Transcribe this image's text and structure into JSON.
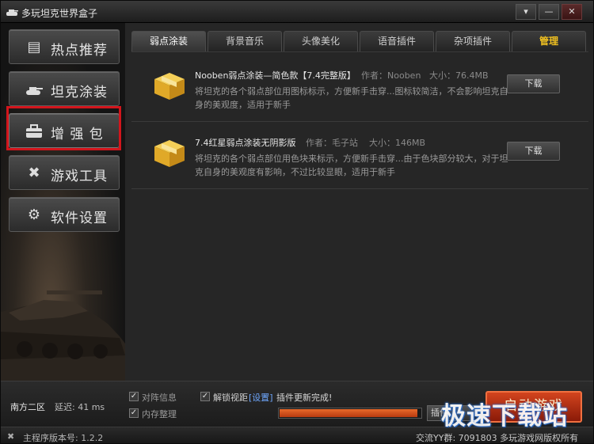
{
  "window": {
    "title": "多玩坦克世界盒子",
    "buttons": {
      "menu": "▾",
      "minimize": "—",
      "close": "✕"
    }
  },
  "sidebar": {
    "items": [
      {
        "label": "热点推荐",
        "icon": "hot-doc-icon"
      },
      {
        "label": "坦克涂装",
        "icon": "tank-icon"
      },
      {
        "label": "增 强 包",
        "icon": "briefcase-icon",
        "highlighted": true
      },
      {
        "label": "游戏工具",
        "icon": "tools-icon"
      },
      {
        "label": "软件设置",
        "icon": "gear-icon"
      }
    ]
  },
  "tabs": [
    {
      "label": "弱点涂装",
      "active": true
    },
    {
      "label": "背景音乐"
    },
    {
      "label": "头像美化"
    },
    {
      "label": "语音插件"
    },
    {
      "label": "杂项插件"
    },
    {
      "label": "管理"
    }
  ],
  "plugins": [
    {
      "title": "Nooben弱点涂装—简色款【7.4完整版】",
      "author": "作者：Nooben",
      "size": "大小：76.4MB",
      "desc": "将坦克的各个弱点部位用图标标示，方便新手击穿...图标较简洁，不会影响坦克自身的美观度，适用于新手",
      "download_label": "下载"
    },
    {
      "title": "7.4红星弱点涂装无阴影版",
      "author": "作者：毛子站",
      "size": "大小：146MB",
      "desc": "将坦克的各个弱点部位用色块来标示，方便新手击穿...由于色块部分较大，对于坦克自身的美观度有影响，不过比较显眼，适用于新手",
      "download_label": "下载"
    }
  ],
  "bottom": {
    "server": "南方二区",
    "latency": "延迟: 41 ms",
    "options": [
      {
        "label": "对阵信息",
        "checked": true
      },
      {
        "label": "内存整理",
        "checked": true
      }
    ],
    "unlock_view": {
      "label": "解锁视距",
      "checked": true,
      "link": "[设置]"
    },
    "status_text": "插件更新完成!",
    "progress": 0.98,
    "plugin_button": "插件",
    "launch_button": "启动游戏"
  },
  "statusbar": {
    "version": "主程序版本号: 1.2.2",
    "qq_group": "交流YY群: 7091803 多玩游戏网版权所有"
  },
  "watermark": "极速下载站",
  "colors": {
    "highlight_red": "#d2151c",
    "manage_tab": "#f0c020",
    "launch": "#c23a18"
  }
}
